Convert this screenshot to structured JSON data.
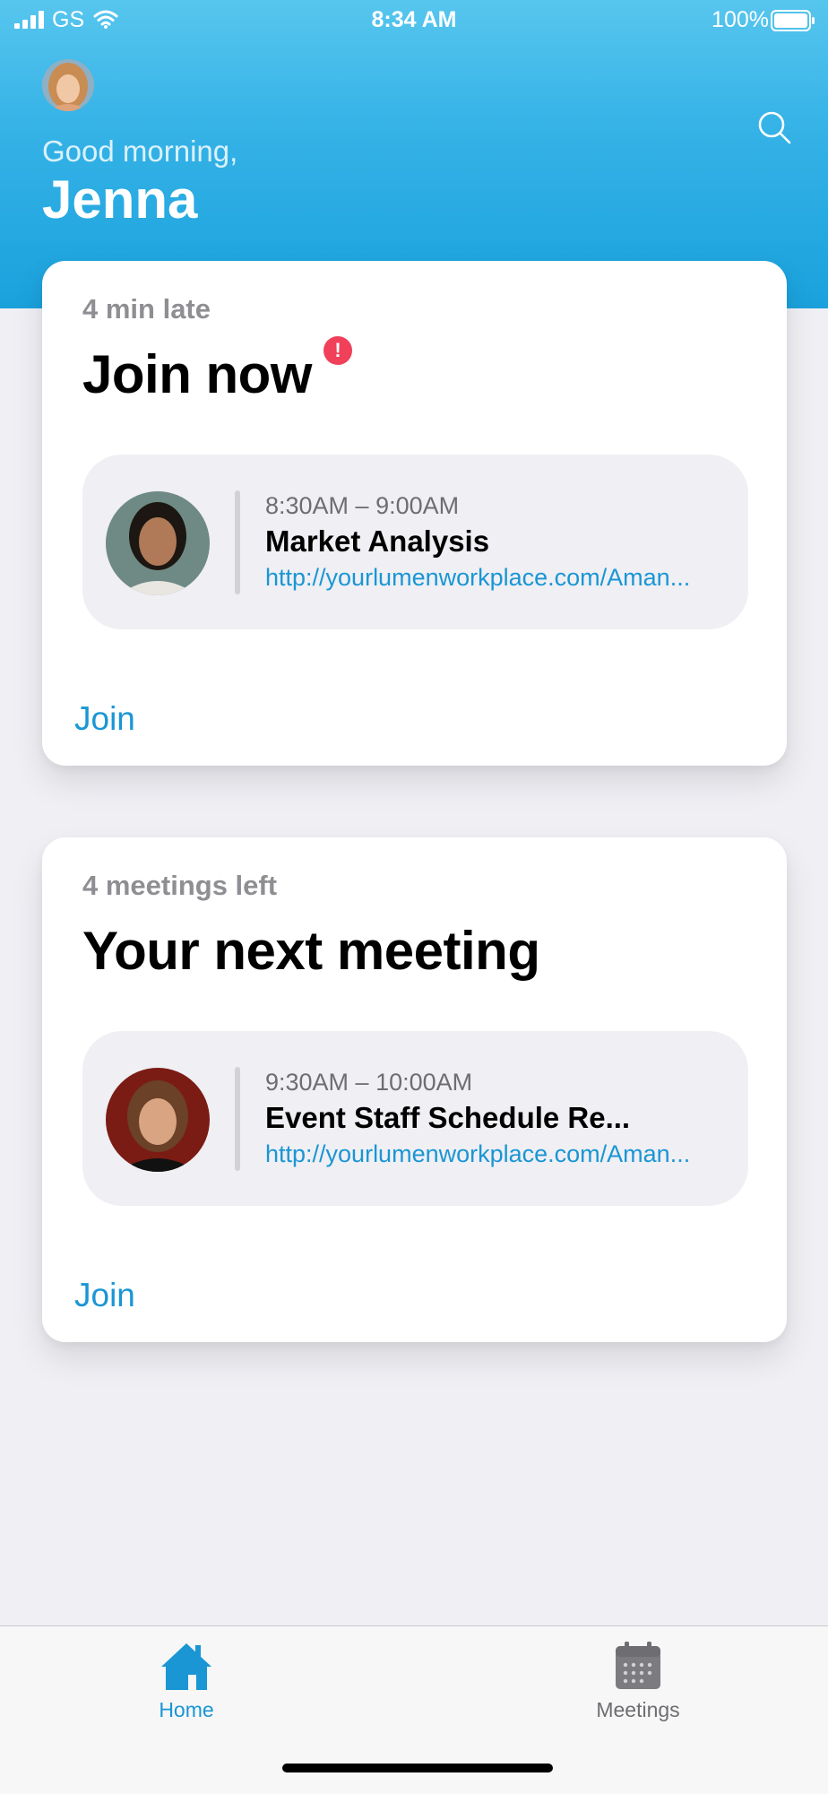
{
  "status_bar": {
    "carrier": "GS",
    "time": "8:34 AM",
    "battery": "100%"
  },
  "header": {
    "greeting": "Good morning,",
    "user_name": "Jenna"
  },
  "cards": [
    {
      "subtitle": "4 min late",
      "title": "Join now",
      "alert": "!",
      "meeting": {
        "time": "8:30AM – 9:00AM",
        "name": "Market Analysis",
        "link": "http://yourlumenworkplace.com/Aman..."
      },
      "action_label": "Join"
    },
    {
      "subtitle": "4 meetings left",
      "title": "Your next meeting",
      "meeting": {
        "time": "9:30AM – 10:00AM",
        "name": "Event Staff Schedule Re...",
        "link": "http://yourlumenworkplace.com/Aman..."
      },
      "action_label": "Join"
    }
  ],
  "tab_bar": {
    "items": [
      {
        "label": "Home",
        "icon": "home-icon",
        "active": true
      },
      {
        "label": "Meetings",
        "icon": "calendar-icon",
        "active": false
      }
    ]
  },
  "colors": {
    "header_gradient_top": "#57c6ee",
    "header_gradient_bottom": "#1aa1dc",
    "accent": "#1a96d4",
    "alert": "#f0405a",
    "background": "#efeff4",
    "secondary_text": "#8e8e93"
  }
}
